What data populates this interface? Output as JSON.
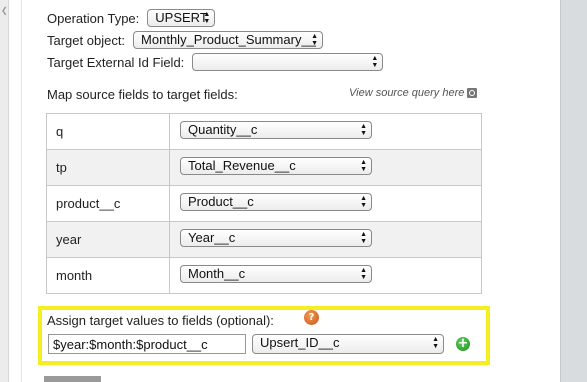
{
  "form": {
    "operation_type_label": "Operation Type:",
    "operation_type_value": "UPSERT",
    "target_object_label": "Target object:",
    "target_object_value": "Monthly_Product_Summary__",
    "target_external_id_label": "Target External Id Field:",
    "target_external_id_value": ""
  },
  "mapping": {
    "heading": "Map source fields to target fields:",
    "view_query_link": "View source query here",
    "rows": [
      {
        "source": "q",
        "target": "Quantity__c"
      },
      {
        "source": "tp",
        "target": "Total_Revenue__c"
      },
      {
        "source": "product__c",
        "target": "Product__c"
      },
      {
        "source": "year",
        "target": "Year__c"
      },
      {
        "source": "month",
        "target": "Month__c"
      }
    ]
  },
  "assign": {
    "label": "Assign target values to fields (optional):",
    "help_icon": "?",
    "value_input": "$year:$month:$product__c",
    "field_select": "Upsert_ID__c",
    "add_icon": "+"
  },
  "colors": {
    "highlight": "#f5ef22",
    "help_icon": "#d9642a",
    "add_icon": "#2e9e2e"
  }
}
